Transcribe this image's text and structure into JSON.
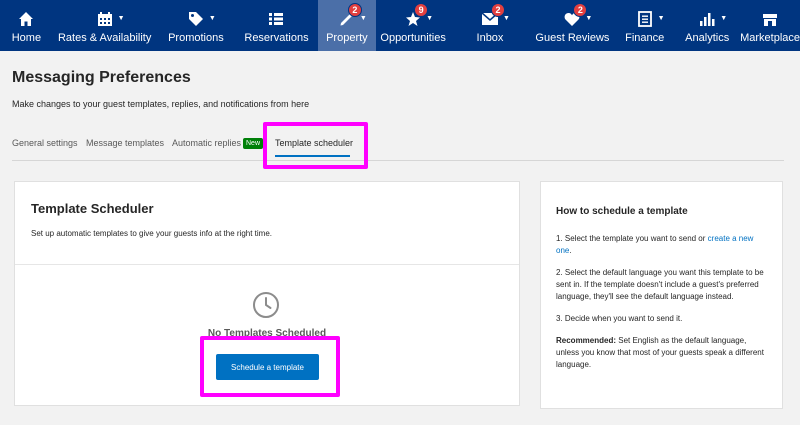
{
  "nav": {
    "items": [
      {
        "label": "Home",
        "icon": "home-icon"
      },
      {
        "label": "Rates & Availability",
        "icon": "calendar-icon"
      },
      {
        "label": "Promotions",
        "icon": "tag-icon"
      },
      {
        "label": "Reservations",
        "icon": "list-icon"
      },
      {
        "label": "Property",
        "icon": "pencil-icon",
        "badge": "2"
      },
      {
        "label": "Opportunities",
        "icon": "star-icon",
        "badge": "9"
      },
      {
        "label": "Inbox",
        "icon": "envelope-icon",
        "badge": "2"
      },
      {
        "label": "Guest Reviews",
        "icon": "heart-icon",
        "badge": "2"
      },
      {
        "label": "Finance",
        "icon": "document-icon"
      },
      {
        "label": "Analytics",
        "icon": "bar-chart-icon"
      },
      {
        "label": "Marketplace",
        "icon": "store-icon"
      }
    ]
  },
  "page": {
    "title": "Messaging Preferences",
    "subtitle": "Make changes to your guest templates, replies, and notifications from here"
  },
  "tabs": [
    {
      "label": "General settings"
    },
    {
      "label": "Message templates"
    },
    {
      "label": "Automatic replies",
      "badge": "New"
    },
    {
      "label": "Template scheduler",
      "active": true
    }
  ],
  "scheduler": {
    "title": "Template Scheduler",
    "description": "Set up automatic templates to give your guests info at the right time.",
    "empty_text": "No Templates Scheduled",
    "button_label": "Schedule a template"
  },
  "help": {
    "title": "How to schedule a template",
    "step1_text": "1. Select the template you want to send or ",
    "step1_link": "create a new one",
    "step1_end": ".",
    "step2": "2. Select the default language you want this template to be sent in. If the template doesn't include a guest's preferred language, they'll see the default language instead.",
    "step3": "3. Decide when you want to send it.",
    "recommended_label": "Recommended:",
    "recommended_text": " Set English as the default language, unless you know that most of your guests speak a different language."
  },
  "colors": {
    "nav_bg": "#003580",
    "nav_active": "#4b6fa8",
    "accent": "#0071c2",
    "badge_red": "#e23f3f",
    "new_green": "#008009",
    "highlight": "#ff00ff"
  }
}
